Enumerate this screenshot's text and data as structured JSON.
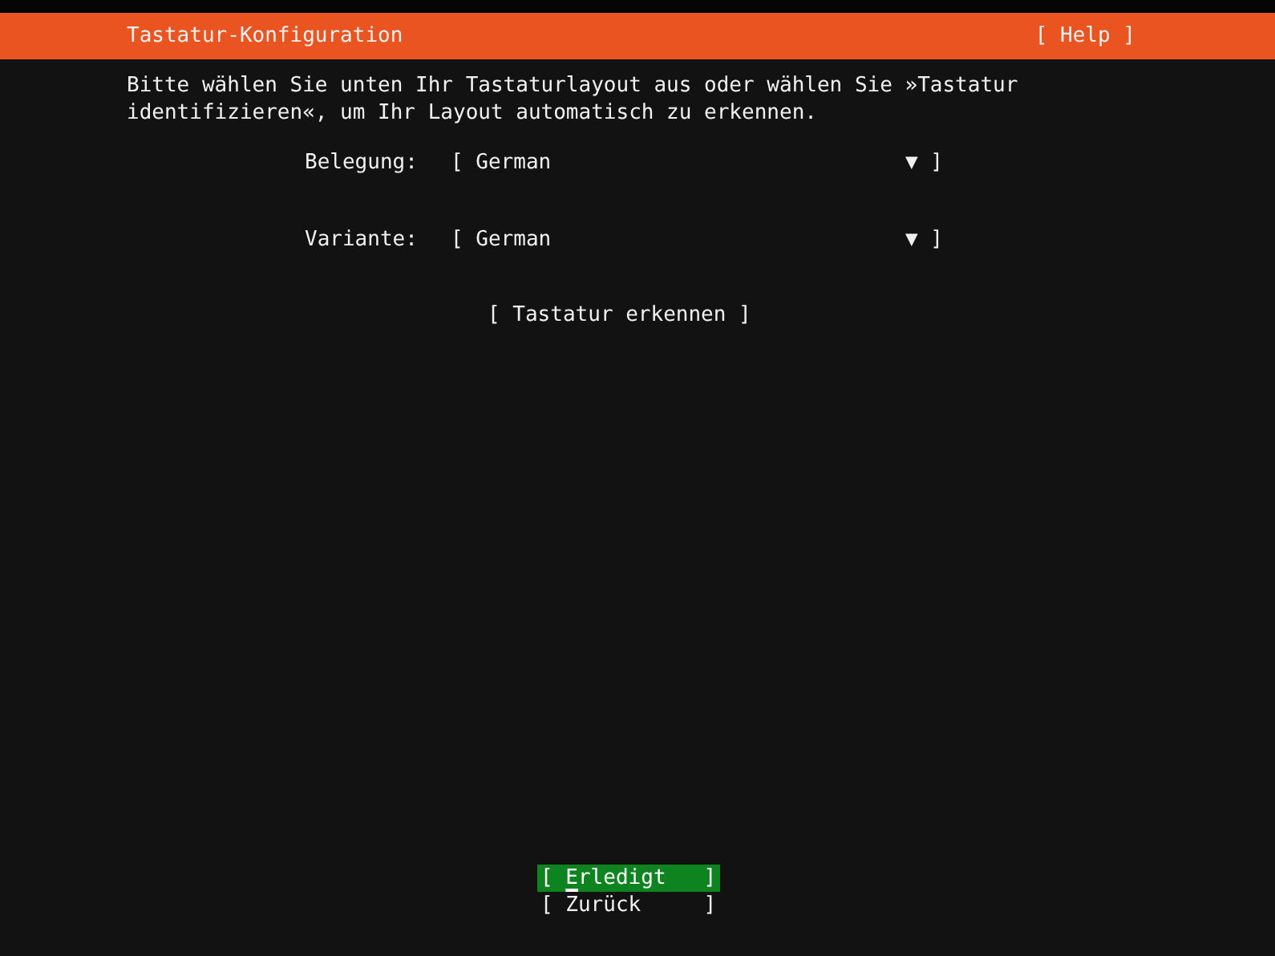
{
  "header": {
    "title": "Tastatur-Konfiguration",
    "help": "[ Help ]"
  },
  "intro": "Bitte wählen Sie unten Ihr Tastaturlayout aus oder wählen Sie »Tastatur identifizieren«, um Ihr Layout automatisch zu erkennen.",
  "fields": [
    {
      "label": "Belegung:",
      "open": "[",
      "value": "German",
      "arrow": "▼",
      "close": "]"
    },
    {
      "label": "Variante:",
      "open": "[",
      "value": "German",
      "arrow": "▼",
      "close": "]"
    }
  ],
  "identify_button": "[ Tastatur erkennen ]",
  "buttons": [
    {
      "text": "[ Erledigt   ]",
      "selected": true
    },
    {
      "text": "[ Zurück     ]",
      "selected": false
    }
  ]
}
